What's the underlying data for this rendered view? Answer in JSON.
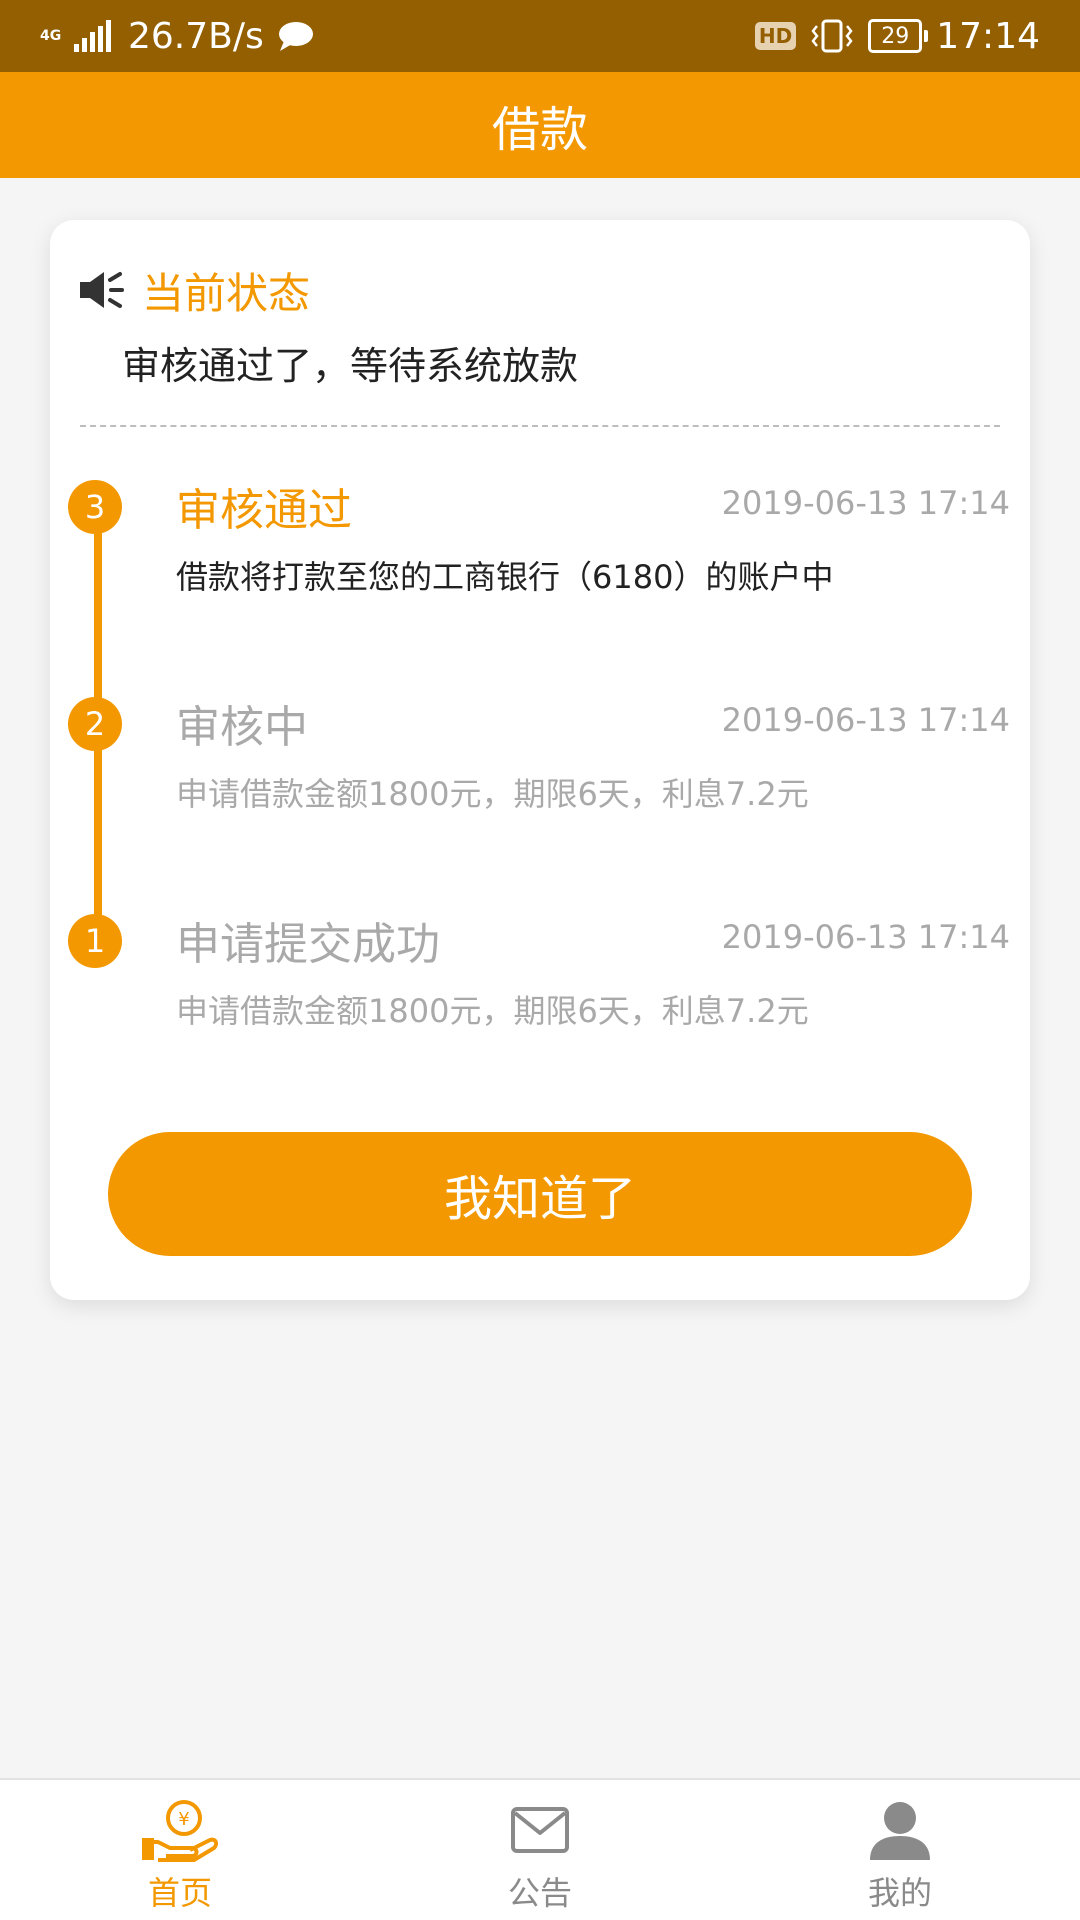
{
  "status_bar": {
    "network": "4G",
    "speed": "26.7B/s",
    "hd": "HD",
    "battery": "29",
    "time": "17:14",
    "icons": [
      "signal-icon",
      "chat-bubble-icon",
      "hd-icon",
      "vibrate-icon",
      "battery-icon"
    ]
  },
  "header": {
    "title": "借款"
  },
  "status": {
    "title": "当前状态",
    "description": "审核通过了，等待系统放款",
    "icon": "speaker-icon"
  },
  "steps": [
    {
      "number": "3",
      "title": "审核通过",
      "time": "2019-06-13 17:14",
      "desc": "借款将打款至您的工商银行（6180）的账户中"
    },
    {
      "number": "2",
      "title": "审核中",
      "time": "2019-06-13 17:14",
      "desc": "申请借款金额1800元，期限6天，利息7.2元"
    },
    {
      "number": "1",
      "title": "申请提交成功",
      "time": "2019-06-13 17:14",
      "desc": "申请借款金额1800元，期限6天，利息7.2元"
    }
  ],
  "button": {
    "label": "我知道了"
  },
  "tabs": [
    {
      "label": "首页",
      "icon": "coin-hand-icon",
      "active": true
    },
    {
      "label": "公告",
      "icon": "envelope-icon",
      "active": false
    },
    {
      "label": "我的",
      "icon": "person-icon",
      "active": false
    }
  ],
  "colors": {
    "accent": "#f39800",
    "status_bar": "#935f00",
    "muted": "#a9a9a9"
  }
}
